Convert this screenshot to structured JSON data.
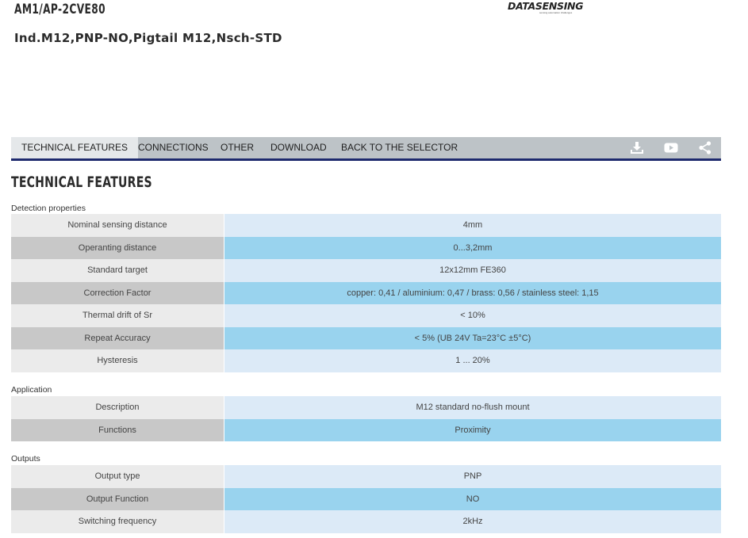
{
  "product": {
    "code": "AM1/AP-2CVE80",
    "description": "Ind.M12,PNP-NO,Pigtail M12,Nsch-STD"
  },
  "logo": {
    "text": "DATASENSING",
    "tagline": "sensing automation challenges"
  },
  "nav": {
    "tabs": [
      {
        "label": "TECHNICAL FEATURES",
        "active": true
      },
      {
        "label": "CONNECTIONS",
        "active": false
      },
      {
        "label": "OTHER",
        "active": false
      },
      {
        "label": "DOWNLOAD",
        "active": false
      },
      {
        "label": "BACK TO THE SELECTOR",
        "active": false
      }
    ],
    "icons": [
      "download-icon",
      "youtube-icon",
      "share-icon"
    ]
  },
  "section_title": "TECHNICAL FEATURES",
  "groups": [
    {
      "label": "Detection properties",
      "rows": [
        {
          "key": "Nominal sensing distance",
          "value": "4mm"
        },
        {
          "key": "Operanting distance",
          "value": "0...3,2mm"
        },
        {
          "key": "Standard target",
          "value": "12x12mm FE360"
        },
        {
          "key": "Correction Factor",
          "value": "copper: 0,41 / aluminium: 0,47 / brass: 0,56 / stainless steel: 1,15"
        },
        {
          "key": "Thermal drift of Sr",
          "value": "< 10%"
        },
        {
          "key": "Repeat Accuracy",
          "value": "< 5% (UB 24V Ta=23°C ±5°C)"
        },
        {
          "key": "Hysteresis",
          "value": "1 ... 20%"
        }
      ]
    },
    {
      "label": "Application",
      "rows": [
        {
          "key": "Description",
          "value": "M12 standard no-flush mount"
        },
        {
          "key": "Functions",
          "value": "Proximity"
        }
      ]
    },
    {
      "label": "Outputs",
      "rows": [
        {
          "key": "Output type",
          "value": "PNP"
        },
        {
          "key": "Output Function",
          "value": "NO"
        },
        {
          "key": "Switching frequency",
          "value": "2kHz"
        }
      ]
    }
  ],
  "colors": {
    "nav_bg": "#bdc3c7",
    "nav_border": "#1e2a6e",
    "row_value_light": "#dceaf7",
    "row_value_dark": "#99d3ee"
  }
}
